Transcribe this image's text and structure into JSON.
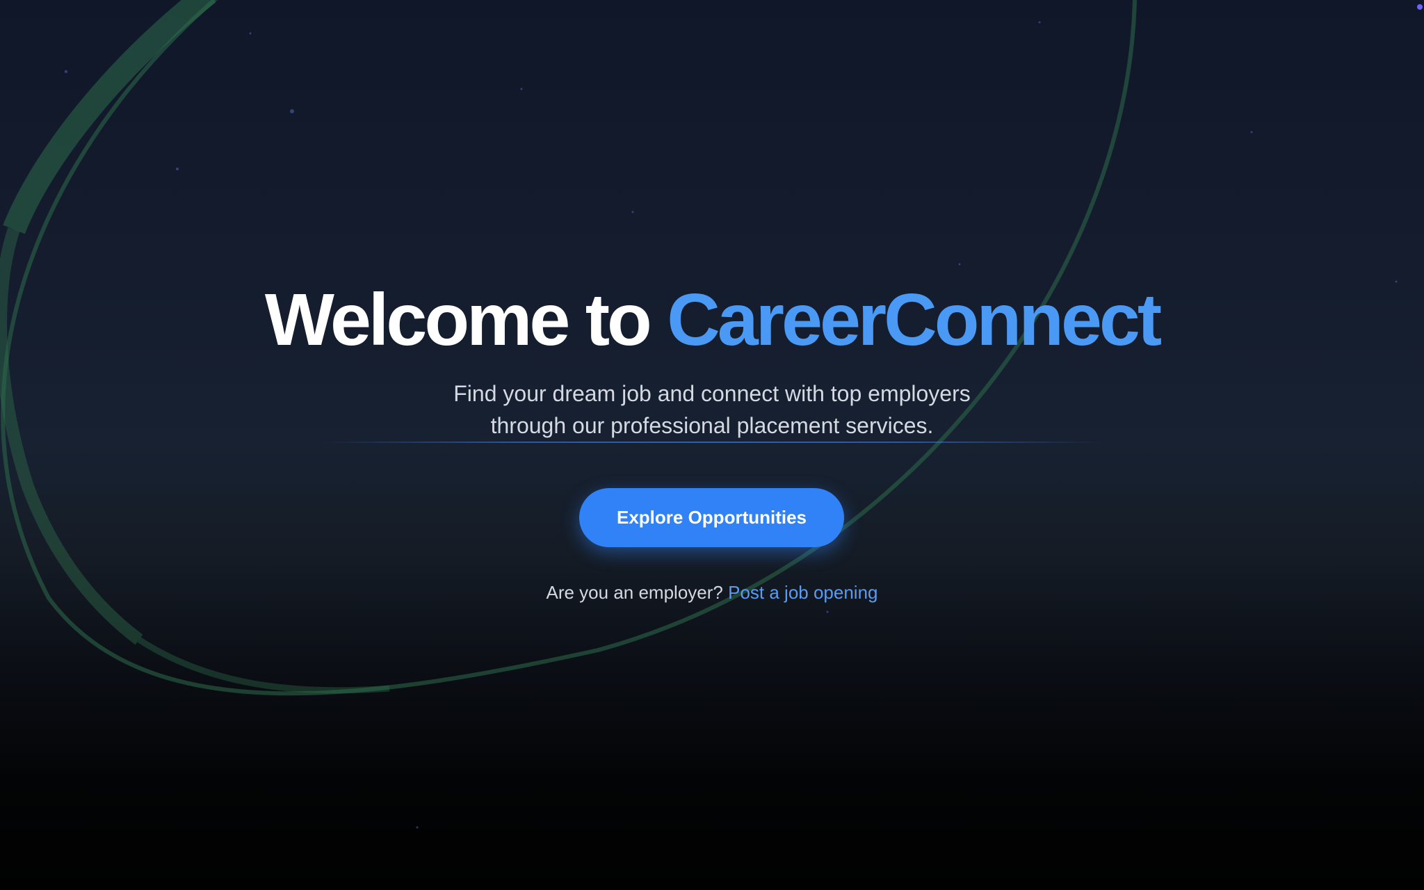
{
  "hero": {
    "title_prefix": "Welcome to",
    "title_brand": "CareerConnect",
    "subtitle_line1": "Find your dream job and connect with top employers",
    "subtitle_line2": "through our professional placement services.",
    "cta_label": "Explore Opportunities",
    "employer_prompt": "Are you an employer?",
    "employer_link": "Post a job opening"
  },
  "colors": {
    "brand": "#4a9af5",
    "button": "#3182f6",
    "link": "#5b9cf0",
    "text_muted": "#d4d9e2",
    "ring": "#2e6b4a"
  }
}
